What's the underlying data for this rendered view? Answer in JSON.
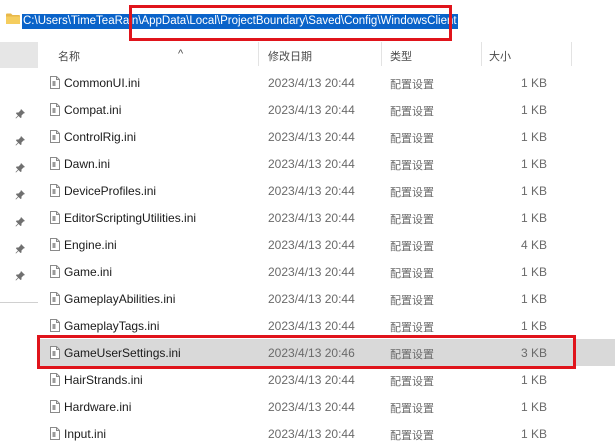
{
  "address_bar": {
    "path": "C:\\Users\\TimeTeaRain\\AppData\\Local\\ProjectBoundary\\Saved\\Config\\WindowsClient"
  },
  "columns": {
    "name": "名称",
    "date_modified": "修改日期",
    "type": "类型",
    "size": "大小"
  },
  "files": [
    {
      "name": "CommonUI.ini",
      "date": "2023/4/13 20:44",
      "type": "配置设置",
      "size": "1 KB"
    },
    {
      "name": "Compat.ini",
      "date": "2023/4/13 20:44",
      "type": "配置设置",
      "size": "1 KB"
    },
    {
      "name": "ControlRig.ini",
      "date": "2023/4/13 20:44",
      "type": "配置设置",
      "size": "1 KB"
    },
    {
      "name": "Dawn.ini",
      "date": "2023/4/13 20:44",
      "type": "配置设置",
      "size": "1 KB"
    },
    {
      "name": "DeviceProfiles.ini",
      "date": "2023/4/13 20:44",
      "type": "配置设置",
      "size": "1 KB"
    },
    {
      "name": "EditorScriptingUtilities.ini",
      "date": "2023/4/13 20:44",
      "type": "配置设置",
      "size": "1 KB"
    },
    {
      "name": "Engine.ini",
      "date": "2023/4/13 20:44",
      "type": "配置设置",
      "size": "4 KB"
    },
    {
      "name": "Game.ini",
      "date": "2023/4/13 20:44",
      "type": "配置设置",
      "size": "1 KB"
    },
    {
      "name": "GameplayAbilities.ini",
      "date": "2023/4/13 20:44",
      "type": "配置设置",
      "size": "1 KB"
    },
    {
      "name": "GameplayTags.ini",
      "date": "2023/4/13 20:44",
      "type": "配置设置",
      "size": "1 KB"
    },
    {
      "name": "GameUserSettings.ini",
      "date": "2023/4/13 20:46",
      "type": "配置设置",
      "size": "3 KB",
      "selected": true
    },
    {
      "name": "HairStrands.ini",
      "date": "2023/4/13 20:44",
      "type": "配置设置",
      "size": "1 KB"
    },
    {
      "name": "Hardware.ini",
      "date": "2023/4/13 20:44",
      "type": "配置设置",
      "size": "1 KB"
    },
    {
      "name": "Input.ini",
      "date": "2023/4/13 20:44",
      "type": "配置设置",
      "size": "1 KB"
    }
  ],
  "colors": {
    "highlight_box": "#e0141b",
    "address_selection": "#0a63c9",
    "selected_row": "#d9d9d9"
  },
  "icons": {
    "address_folder": "folder-icon",
    "file": "ini-file-icon",
    "quick_access_pin": "pin-icon"
  }
}
